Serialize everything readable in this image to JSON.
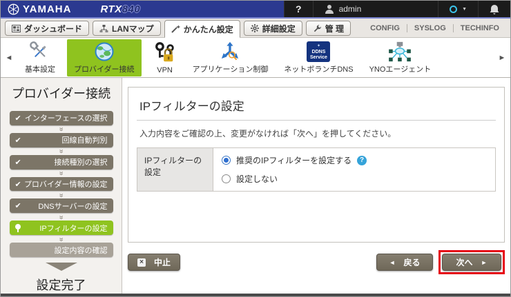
{
  "colors": {
    "topbar_blue": "#2b3990",
    "topbar_black": "#1b1b1b",
    "accent_green": "#8fc31f",
    "step_done_gray": "#7c7567",
    "step_pending_gray": "#a8a298",
    "highlight_red": "#e60012",
    "indicator_cyan": "#3bc3ea"
  },
  "topbar": {
    "brand": "YAMAHA",
    "model": "RTX",
    "model_series": "840",
    "help": "?",
    "user": "admin",
    "caret": "▼"
  },
  "tabbar": {
    "tabs": [
      {
        "label": "ダッシュボード",
        "active": false
      },
      {
        "label": "LANマップ",
        "active": false
      },
      {
        "label": "かんたん設定",
        "active": true
      },
      {
        "label": "詳細設定",
        "active": false
      },
      {
        "label": "管 理",
        "active": false
      }
    ],
    "links": [
      "CONFIG",
      "SYSLOG",
      "TECHINFO"
    ]
  },
  "categories": {
    "scroll_left": "◄",
    "scroll_right": "►",
    "ddns_line1": "DDNS",
    "ddns_line2": "Service",
    "items": [
      {
        "label": "基本設定",
        "active": false
      },
      {
        "label": "プロバイダー接続",
        "active": true
      },
      {
        "label": "VPN",
        "active": false
      },
      {
        "label": "アプリケーション制御",
        "active": false
      },
      {
        "label": "ネットボランチDNS",
        "active": false
      },
      {
        "label": "YNOエージェント",
        "active": false
      }
    ]
  },
  "sidebar": {
    "title": "プロバイダー接続",
    "check": "✔",
    "sep": "»",
    "steps": [
      {
        "label": "インターフェースの選択",
        "state": "done"
      },
      {
        "label": "回線自動判別",
        "state": "done"
      },
      {
        "label": "接続種別の選択",
        "state": "done"
      },
      {
        "label": "プロバイダー情報の設定",
        "state": "done"
      },
      {
        "label": "DNSサーバーの設定",
        "state": "done"
      },
      {
        "label": "IPフィルターの設定",
        "state": "current"
      },
      {
        "label": "設定内容の確認",
        "state": "pending"
      }
    ],
    "finish": "設定完了"
  },
  "main": {
    "title": "IPフィルターの設定",
    "instruction": "入力内容をご確認の上、変更がなければ「次へ」を押してください。",
    "form": {
      "label": "IPフィルターの設定",
      "help_glyph": "?",
      "options": [
        {
          "label": "推奨のIPフィルターを設定する",
          "selected": true,
          "has_help": true
        },
        {
          "label": "設定しない",
          "selected": false,
          "has_help": false
        }
      ]
    },
    "actions": {
      "abort": "中止",
      "abort_glyph": "×",
      "back": "戻る",
      "back_arrow": "◄",
      "next": "次へ",
      "next_arrow": "►"
    }
  }
}
